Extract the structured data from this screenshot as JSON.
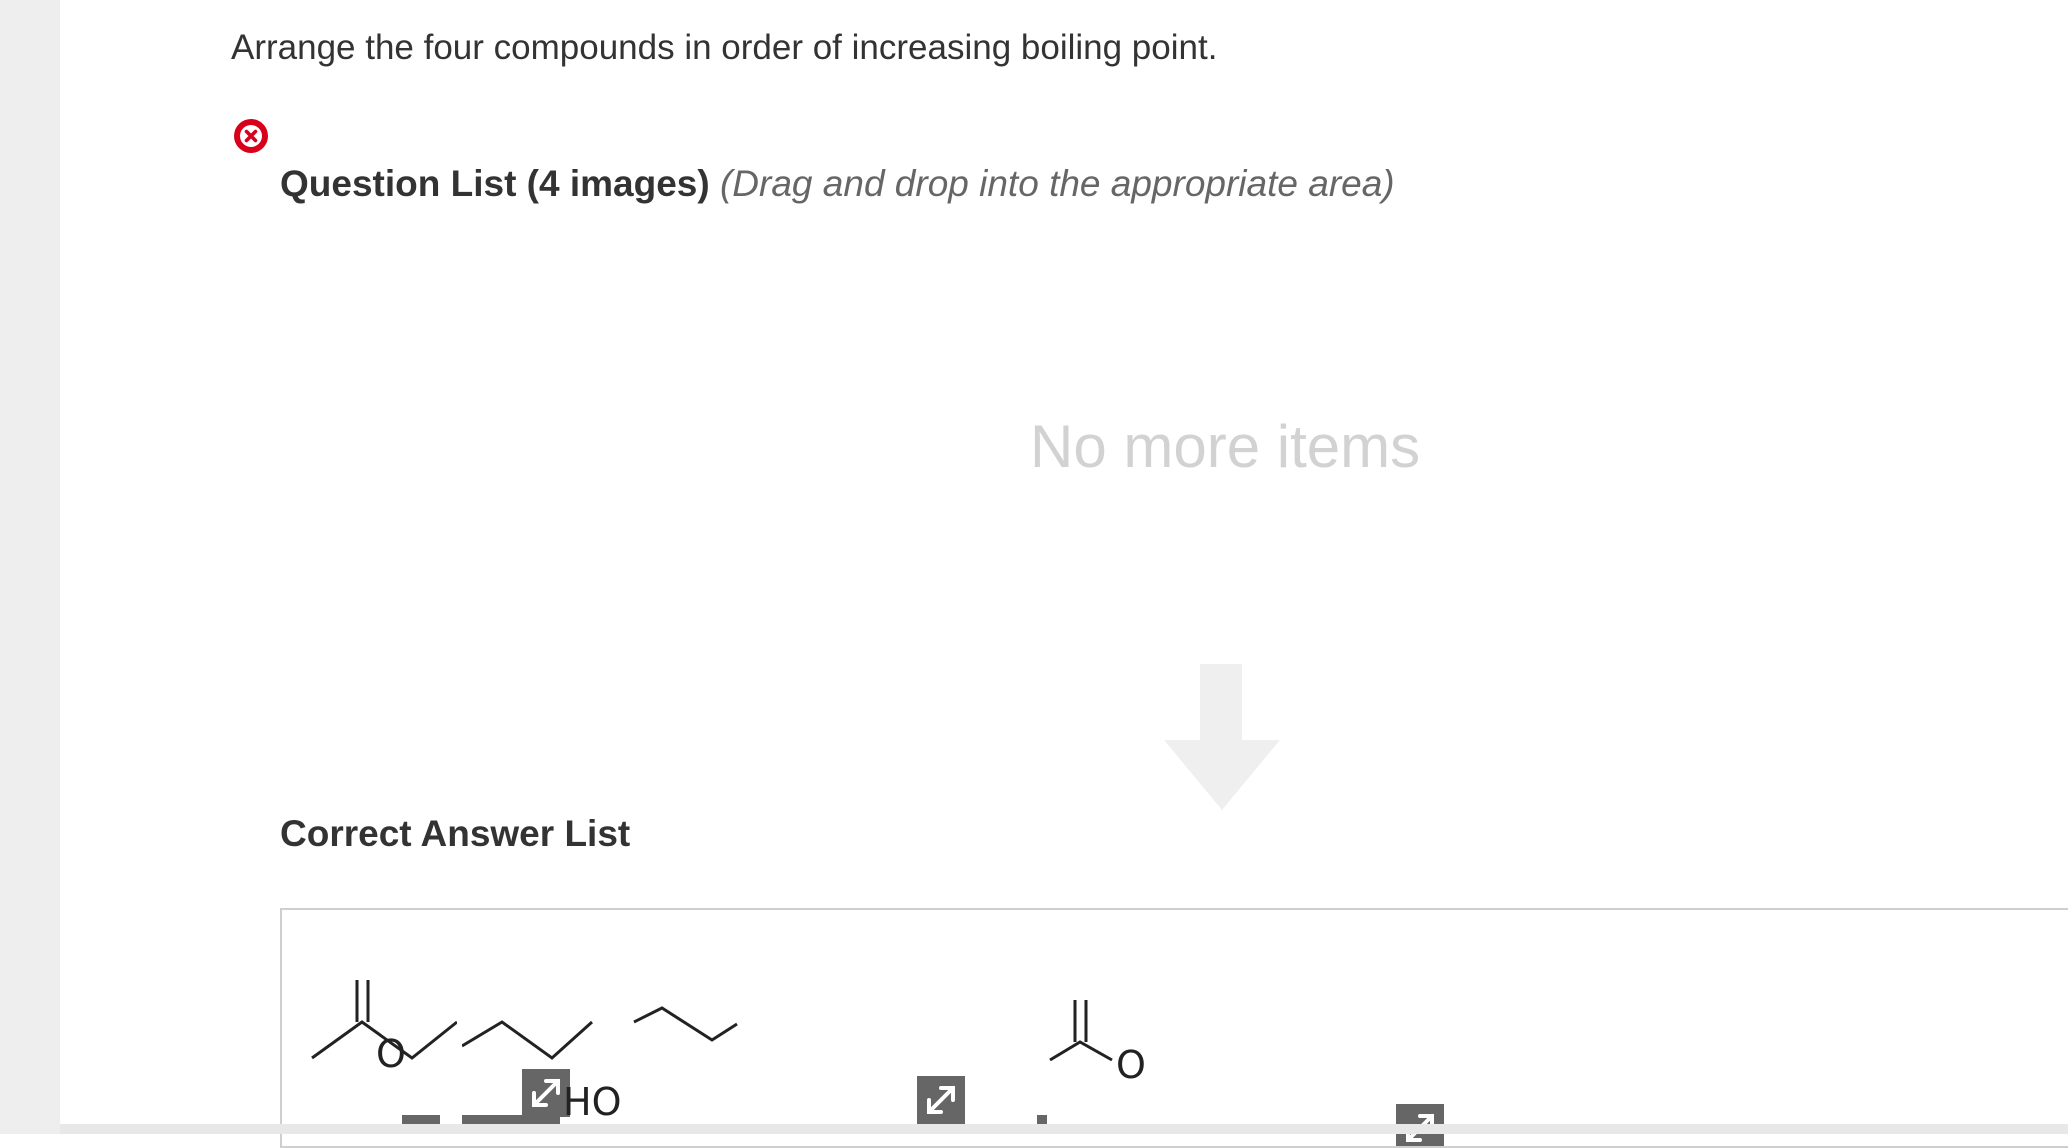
{
  "question": {
    "prompt": "Arrange the four compounds in order of increasing boiling point."
  },
  "question_list": {
    "title": "Question List (4 images)",
    "hint": "(Drag and drop into the appropriate area)",
    "empty_message": "No more items"
  },
  "answer_list": {
    "title": "Correct Answer List",
    "items": [
      {
        "atom_label": "O",
        "enlarge_icon": "expand-icon"
      },
      {
        "atom_label": "HO",
        "enlarge_icon": "expand-icon"
      },
      {
        "atom_label": "O",
        "enlarge_icon": "expand-icon"
      }
    ]
  },
  "icons": {
    "status": "error-x-icon",
    "drop_hint": "down-arrow-icon"
  },
  "colors": {
    "error_red": "#d9001b",
    "empty_text": "#d2d2d2",
    "arrow": "#efefef"
  }
}
